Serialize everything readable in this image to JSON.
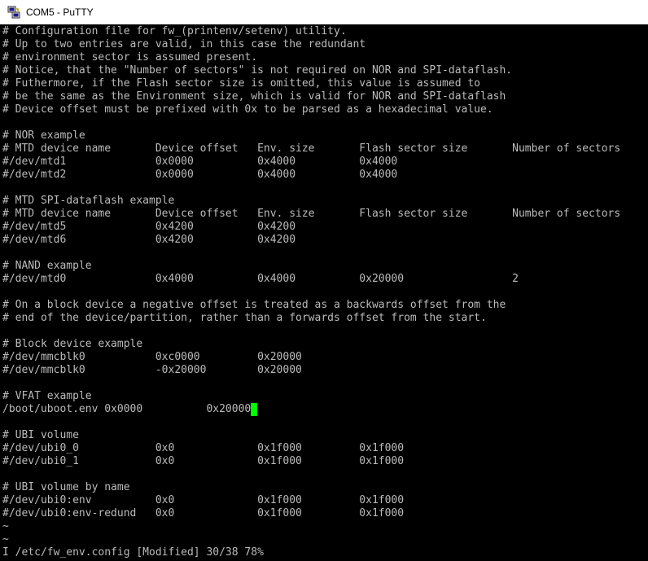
{
  "window": {
    "title": "COM5 - PuTTY",
    "icon": "putty-icon"
  },
  "colors": {
    "terminal_bg": "#000000",
    "terminal_fg": "#bbbbbb",
    "cursor": "#00ff00"
  },
  "terminal": {
    "lines": [
      "# Configuration file for fw_(printenv/setenv) utility.",
      "# Up to two entries are valid, in this case the redundant",
      "# environment sector is assumed present.",
      "# Notice, that the \"Number of sectors\" is not required on NOR and SPI-dataflash.",
      "# Futhermore, if the Flash sector size is omitted, this value is assumed to",
      "# be the same as the Environment size, which is valid for NOR and SPI-dataflash",
      "# Device offset must be prefixed with 0x to be parsed as a hexadecimal value.",
      "",
      "# NOR example",
      "# MTD device name       Device offset   Env. size       Flash sector size       Number of sectors",
      "#/dev/mtd1              0x0000          0x4000          0x4000",
      "#/dev/mtd2              0x0000          0x4000          0x4000",
      "",
      "# MTD SPI-dataflash example",
      "# MTD device name       Device offset   Env. size       Flash sector size       Number of sectors",
      "#/dev/mtd5              0x4200          0x4200",
      "#/dev/mtd6              0x4200          0x4200",
      "",
      "# NAND example",
      "#/dev/mtd0              0x4000          0x4000          0x20000                 2",
      "",
      "# On a block device a negative offset is treated as a backwards offset from the",
      "# end of the device/partition, rather than a forwards offset from the start.",
      "",
      "# Block device example",
      "#/dev/mmcblk0           0xc0000         0x20000",
      "#/dev/mmcblk0           -0x20000        0x20000",
      "",
      "# VFAT example",
      "/boot/uboot.env 0x0000          0x20000",
      "",
      "# UBI volume",
      "#/dev/ubi0_0            0x0             0x1f000         0x1f000",
      "#/dev/ubi0_1            0x0             0x1f000         0x1f000",
      "",
      "# UBI volume by name",
      "#/dev/ubi0:env          0x0             0x1f000         0x1f000",
      "#/dev/ubi0:env-redund   0x0             0x1f000         0x1f000",
      "~",
      "~",
      "I /etc/fw_env.config [Modified] 30/38 78%"
    ]
  }
}
